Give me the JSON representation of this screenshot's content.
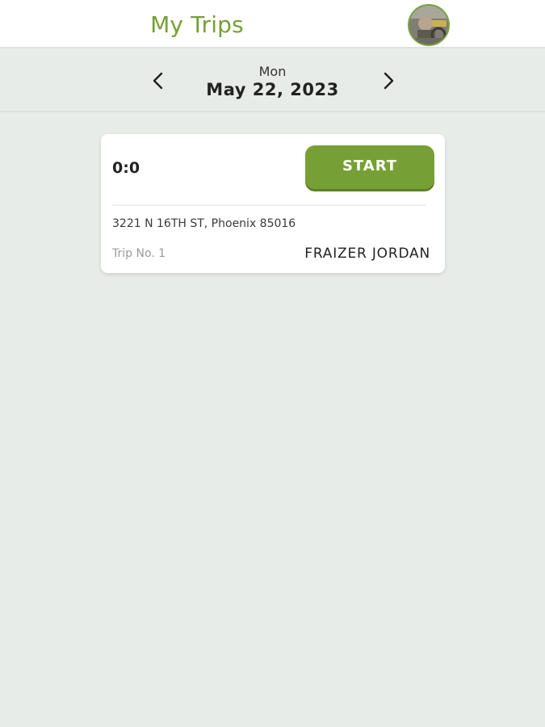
{
  "header": {
    "title": "My Trips",
    "avatar_icon": "profile-photo-icon",
    "accent_color": "#76a035"
  },
  "date_nav": {
    "day": "Mon",
    "date": "May 22, 2023",
    "prev_icon": "chevron-left-icon",
    "next_icon": "chevron-right-icon"
  },
  "trips": [
    {
      "timer": "0:0",
      "start_label": "START",
      "address": "3221 N 16TH ST, Phoenix 85016",
      "trip_no": "Trip No. 1",
      "client_name": "FRAIZER JORDAN"
    }
  ]
}
